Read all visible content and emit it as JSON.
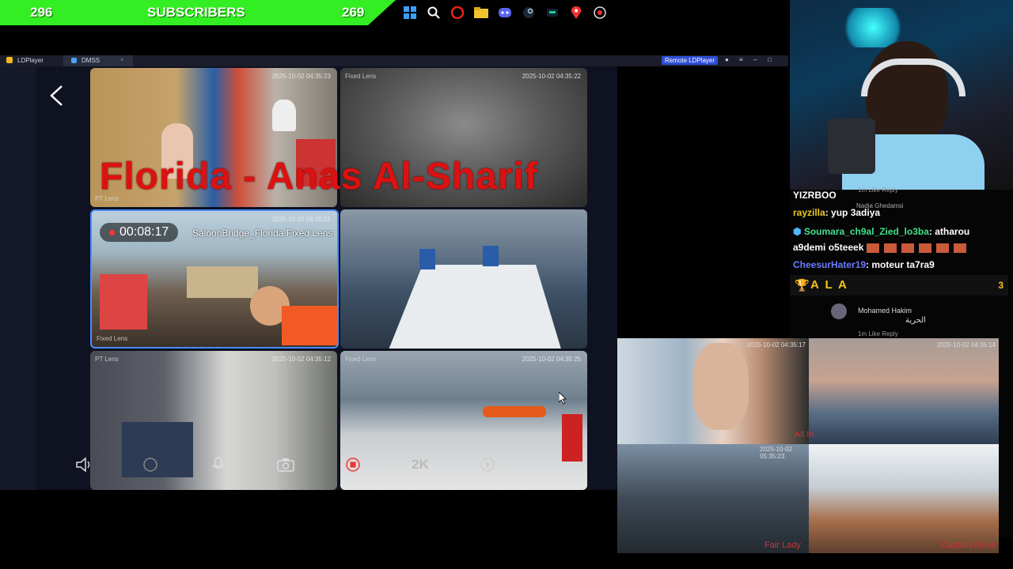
{
  "subs_bar": {
    "left_count": "296",
    "label": "SUBSCRIBERS",
    "right_count": "269"
  },
  "taskbar": {
    "icons": [
      "windows-icon",
      "search-icon",
      "opera-icon",
      "folder-icon",
      "discord-icon",
      "steam-icon",
      "app-icon",
      "maps-pin-icon",
      "record-icon"
    ]
  },
  "emulator": {
    "tabs": [
      {
        "label": "LDPlayer"
      },
      {
        "label": "DMSS"
      }
    ],
    "remote_label": "Remote LDPlayer"
  },
  "cameras": [
    {
      "timestamp": "2025-10-02 04:35:23",
      "label": "PT Lens"
    },
    {
      "timestamp": "2025-10-02 04:35:22",
      "label": "Fixed Lens"
    },
    {
      "timestamp": "2025-10-02 04:35:21",
      "label": "Fixed Lens"
    },
    {
      "timestamp": "",
      "label": ""
    },
    {
      "timestamp": "2025-10-02 04:35:12",
      "label": "PT Lens"
    },
    {
      "timestamp": "2025-10-02 04:35:25",
      "label": "Fixed Lens"
    }
  ],
  "overlay_title": "Florida -  Anas Al-Sharif",
  "recording": {
    "time": "00:08:17",
    "camera_name": "SaloonBridge_Florida Fixed Lens"
  },
  "controls": {
    "quality": "2K"
  },
  "chat": {
    "top_name": "YIZRBOO",
    "top_meta": "1m   Like   Reply",
    "messages": [
      {
        "user": "rayzilla",
        "text": ": yup 3adiya",
        "user_color": "#e8c822"
      },
      {
        "user": "Soumara_ch9al_Zied_lo3ba",
        "text": ": atharou",
        "user_color": "#3fe08a"
      },
      {
        "user": "",
        "text": "a9demi o5teeek",
        "user_color": "#fff"
      },
      {
        "user": "CheesurHater19",
        "text": ": moteur ta7ra9",
        "user_color": "#6a7cff"
      }
    ],
    "nadia": "Nadia Ghedamsi",
    "highlight": {
      "name": "A L A",
      "count": "3"
    },
    "comment": {
      "user": "Mohamed Hakim",
      "text": "الحرية",
      "meta": "1m   Like   Reply"
    }
  },
  "video": {
    "timestamps": [
      "2025-10-02 04:35:17",
      "2025-10-02 04:35:14",
      "2025-10-02 05:35:23"
    ],
    "names": [
      "Fair Lady",
      "Captain Nikos",
      "All In"
    ]
  }
}
